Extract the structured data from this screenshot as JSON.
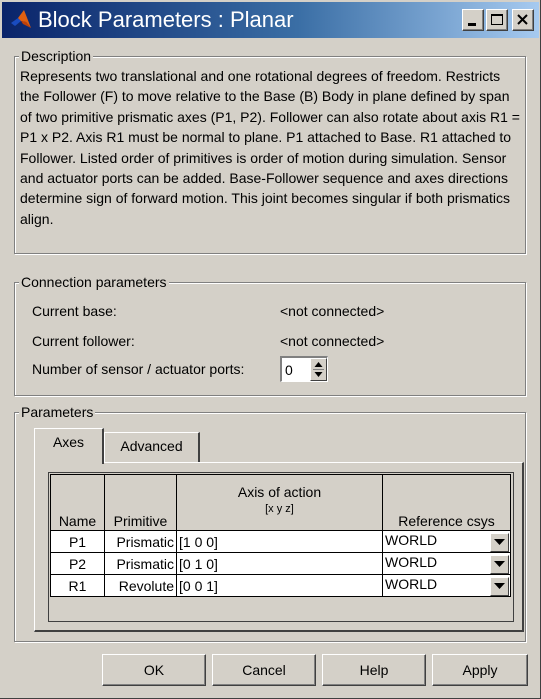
{
  "window": {
    "title": "Block Parameters : Planar",
    "minimize_label": "_",
    "maximize_label": "□",
    "close_label": "x"
  },
  "description": {
    "legend": "Description",
    "text": "Represents two translational and one rotational degrees of freedom. Restricts the Follower (F) to move relative to the Base (B) Body in plane defined by span of two primitive prismatic axes (P1, P2). Follower can also rotate about axis R1 = P1 x P2. Axis R1 must be normal to plane. P1 attached to Base. R1 attached to Follower. Listed order of primitives is order of motion during simulation. Sensor and actuator ports can be added. Base-Follower sequence and axes directions determine sign of forward motion. This joint becomes singular if both prismatics align."
  },
  "connection": {
    "legend": "Connection parameters",
    "base_label": "Current base:",
    "base_value": "<not connected>",
    "follower_label": "Current follower:",
    "follower_value": "<not connected>",
    "ports_label": "Number of sensor / actuator ports:",
    "ports_value": "0"
  },
  "parameters": {
    "legend": "Parameters",
    "tabs": [
      {
        "label": "Axes",
        "active": true
      },
      {
        "label": "Advanced",
        "active": false
      }
    ],
    "columns": {
      "name": "Name",
      "primitive": "Primitive",
      "axis": "Axis of action",
      "axis_sub": "[x y z]",
      "csys": "Reference csys"
    },
    "rows": [
      {
        "name": "P1",
        "primitive": "Prismatic",
        "axis": "[1 0 0]",
        "csys": "WORLD"
      },
      {
        "name": "P2",
        "primitive": "Prismatic",
        "axis": "[0 1 0]",
        "csys": "WORLD"
      },
      {
        "name": "R1",
        "primitive": "Revolute",
        "axis": "[0 0 1]",
        "csys": "WORLD"
      }
    ]
  },
  "buttons": {
    "ok": "OK",
    "cancel": "Cancel",
    "help": "Help",
    "apply": "Apply"
  },
  "colors": {
    "title_start": "#0a246a",
    "title_end": "#a6caf0",
    "face": "#d4d0c8",
    "logo_orange": "#e06010",
    "logo_blue": "#1a4cc0"
  },
  "icons": {
    "app": "matlab-logo-icon",
    "spin": "spin-up-down-icon",
    "dropdown": "chevron-down-icon"
  }
}
